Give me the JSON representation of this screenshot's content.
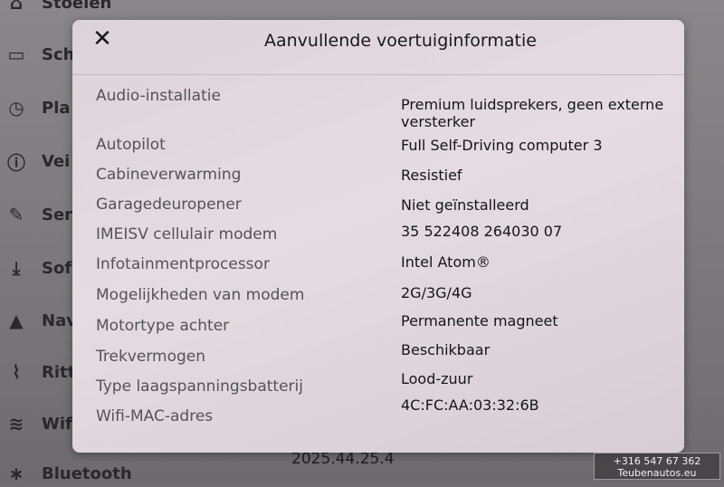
{
  "background": {
    "menu_items": [
      {
        "icon": "car-icon",
        "label": "Stoelen"
      },
      {
        "icon": "display-icon",
        "label": "Sch"
      },
      {
        "icon": "schedule-icon",
        "label": "Pla"
      },
      {
        "icon": "safety-icon",
        "label": "Vei"
      },
      {
        "icon": "wrench-icon",
        "label": "Ser"
      },
      {
        "icon": "download-icon",
        "label": "Sof"
      },
      {
        "icon": "navigation-icon",
        "label": "Nav"
      },
      {
        "icon": "trips-icon",
        "label": "Ritt"
      },
      {
        "icon": "wifi-icon",
        "label": "Wif"
      },
      {
        "icon": "bluetooth-icon",
        "label": "Bluetooth"
      }
    ],
    "software_version": "2025.44.25.4"
  },
  "modal": {
    "title": "Aanvullende voertuiginformatie",
    "close_icon": "close-icon",
    "rows": [
      {
        "label": "Audio-installatie",
        "value": "Premium luidsprekers, geen externe versterker"
      },
      {
        "label": "Autopilot",
        "value": "Full Self-Driving computer 3"
      },
      {
        "label": "Cabineverwarming",
        "value": "Resistief"
      },
      {
        "label": "Garagedeuropener",
        "value": "Niet geïnstalleerd"
      },
      {
        "label": "IMEISV cellulair modem",
        "value": "35 522408 264030 07"
      },
      {
        "label": "Infotainmentprocessor",
        "value": "Intel Atom®"
      },
      {
        "label": "Mogelijkheden van modem",
        "value": "2G/3G/4G"
      },
      {
        "label": "Motortype achter",
        "value": "Permanente magneet"
      },
      {
        "label": "Trekvermogen",
        "value": "Beschikbaar"
      },
      {
        "label": "Type laagspanningsbatterij",
        "value": "Lood-zuur"
      },
      {
        "label": "Wifi-MAC-adres",
        "value": "4C:FC:AA:03:32:6B"
      }
    ]
  },
  "watermark": {
    "phone": "+316 547 67 362",
    "site": "Teubenautos.eu"
  }
}
